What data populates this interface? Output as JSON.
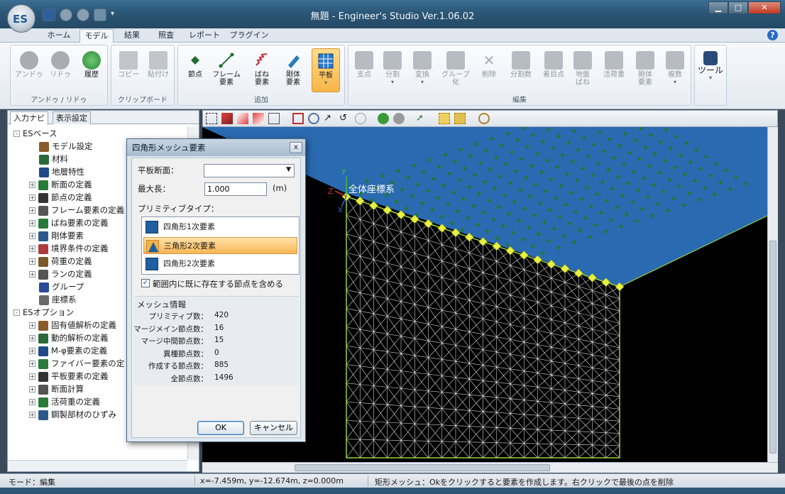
{
  "window": {
    "title": "無題 - Engineer's Studio Ver.1.06.02",
    "logo_text": "ES",
    "help": "?"
  },
  "ribbon_tabs": [
    "ホーム",
    "モデル",
    "結果",
    "照査",
    "レポート",
    "プラグイン"
  ],
  "ribbon": {
    "undo_group": {
      "label": "アンドゥ / リドゥ",
      "undo": "アンドゥ",
      "redo": "リドゥ",
      "history": "履歴"
    },
    "clipboard_group": {
      "label": "クリップボード",
      "copy": "コピー",
      "paste": "貼付け"
    },
    "add_group": {
      "label": "追加",
      "node": "節点",
      "frame": "フレーム\n要素",
      "spring": "ばね\n要素",
      "rigid": "剛体\n要素",
      "plate": "平板"
    },
    "edit_group": {
      "label": "編集",
      "support": "支点",
      "split": "分割",
      "transform": "変換",
      "group": "グループ\n化",
      "delete": "削除",
      "split_count": "分割数",
      "focus_point": "着目点",
      "ground_spring": "地盤\nばね",
      "live_load": "活荷重",
      "rigid_elem": "剛体\n要素",
      "duplicate": "複数"
    },
    "tool_group": {
      "tool": "ツール"
    }
  },
  "left_panel": {
    "tabs": [
      "入力ナビ",
      "表示設定"
    ],
    "tree": [
      {
        "label": "ESベース",
        "level": 0,
        "exp": "-"
      },
      {
        "label": "モデル設定",
        "level": 2,
        "exp": ""
      },
      {
        "label": "材料",
        "level": 2,
        "exp": ""
      },
      {
        "label": "地層特性",
        "level": 2,
        "exp": ""
      },
      {
        "label": "断面の定義",
        "level": 1,
        "exp": "+"
      },
      {
        "label": "節点の定義",
        "level": 1,
        "exp": "+"
      },
      {
        "label": "フレーム要素の定義",
        "level": 1,
        "exp": "+"
      },
      {
        "label": "ばね要素の定義",
        "level": 1,
        "exp": "+"
      },
      {
        "label": "剛体要素",
        "level": 1,
        "exp": "+"
      },
      {
        "label": "境界条件の定義",
        "level": 1,
        "exp": "+"
      },
      {
        "label": "荷重の定義",
        "level": 1,
        "exp": "+"
      },
      {
        "label": "ランの定義",
        "level": 1,
        "exp": "+"
      },
      {
        "label": "グループ",
        "level": 2,
        "exp": ""
      },
      {
        "label": "座標系",
        "level": 2,
        "exp": ""
      },
      {
        "label": "ESオプション",
        "level": 0,
        "exp": "-"
      },
      {
        "label": "固有値解析の定義",
        "level": 1,
        "exp": "+"
      },
      {
        "label": "動的解析の定義",
        "level": 1,
        "exp": "+"
      },
      {
        "label": "M-φ要素の定義",
        "level": 1,
        "exp": "+"
      },
      {
        "label": "ファイバー要素の定",
        "level": 1,
        "exp": "+"
      },
      {
        "label": "平板要素の定義",
        "level": 1,
        "exp": "+"
      },
      {
        "label": "断面計算",
        "level": 1,
        "exp": "+"
      },
      {
        "label": "活荷重の定義",
        "level": 1,
        "exp": "+"
      },
      {
        "label": "鋼製部材のひずみ",
        "level": 1,
        "exp": "+"
      }
    ]
  },
  "viewport": {
    "coord_label": "全体座標系",
    "axis_y": "Y",
    "axis_z": "Z",
    "axis_x": "X"
  },
  "dialog": {
    "title": "四角形メッシュ要素",
    "section_label": "平板断面：",
    "section_value": "",
    "max_len_label": "最大長：",
    "max_len_value": "1.000",
    "max_len_unit": "(m)",
    "primitive_label": "プリミティブタイプ：",
    "primitives": [
      "四角形1次要素",
      "三角形2次要素",
      "四角形2次要素"
    ],
    "selected_primitive": 1,
    "include_label": "範囲内に既に存在する節点を含める",
    "include_checked": "✓",
    "mesh_info_label": "メッシュ情報",
    "mesh_info": [
      {
        "k": "プリミティブ数：",
        "v": "420"
      },
      {
        "k": "マージメイン節点数：",
        "v": "16"
      },
      {
        "k": "マージ中間節点数：",
        "v": "15"
      },
      {
        "k": "異種節点数：",
        "v": "0"
      },
      {
        "k": "作成する節点数：",
        "v": "885"
      },
      {
        "k": "全節点数：",
        "v": "1496"
      }
    ],
    "ok": "OK",
    "cancel": "キャンセル"
  },
  "status": {
    "mode": "モード：編集",
    "coords": "x=-7.459m, y=-12.674m, z=0.000m",
    "message": "矩形メッシュ：Okをクリックすると要素を作成します。右クリックで最後の点を削除"
  }
}
